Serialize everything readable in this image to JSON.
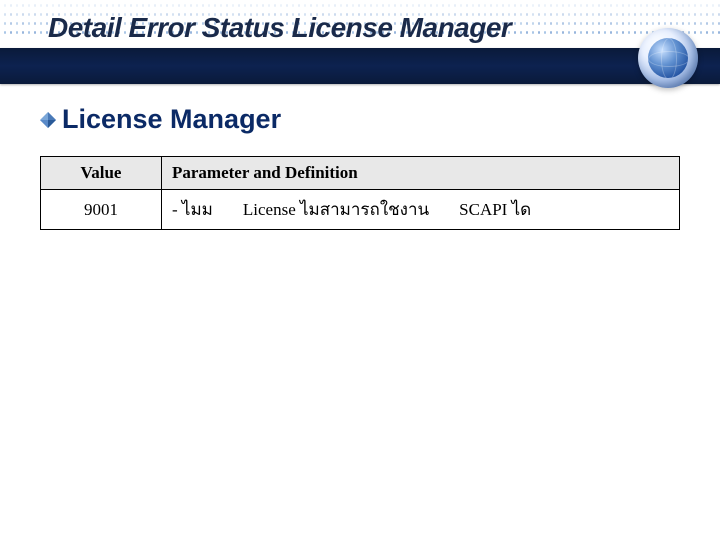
{
  "title": "Detail Error Status License Manager",
  "section_heading": "License Manager",
  "table": {
    "headers": {
      "value": "Value",
      "definition": "Parameter and Definition"
    },
    "rows": [
      {
        "value": "9001",
        "def_part1": "- ไมม",
        "def_part2": "License ไมสามารถใชงาน",
        "def_part3": "SCAPI ได"
      }
    ]
  },
  "colors": {
    "title_text": "#1a2a4a",
    "heading_text": "#0b2a66",
    "nav_bar": "#0d2250",
    "table_header_bg": "#e8e8e8",
    "border": "#000000"
  }
}
